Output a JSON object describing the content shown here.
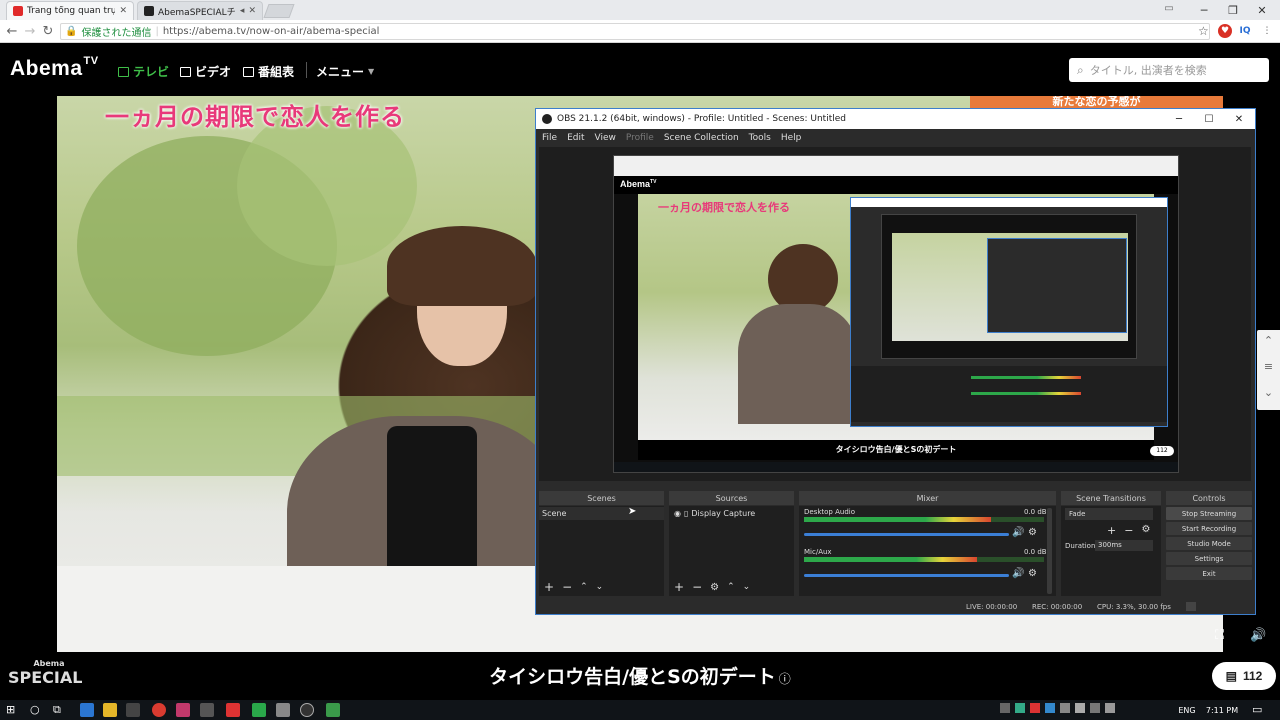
{
  "browser": {
    "tabs": [
      {
        "title": "Trang tổng quan trực tiế",
        "favicon_color": "#e02a2a"
      },
      {
        "title": "AbemaSPECIALチャンネ",
        "favicon_color": "#222222"
      }
    ],
    "secure_label": "保護された通信",
    "url": "https://abema.tv/now-on-air/abema-special",
    "extensions": [
      "IQ"
    ]
  },
  "abema": {
    "logo": "Abema",
    "logo_sup": "TV",
    "nav": [
      {
        "label": "テレビ",
        "active": true
      },
      {
        "label": "ビデオ",
        "active": false
      },
      {
        "label": "番組表",
        "active": false
      }
    ],
    "menu_label": "メニュー",
    "search_placeholder": "タイトル, 出演者を検索"
  },
  "video": {
    "caption": "一ヵ月の期限で恋人を作る",
    "top_right_caption": "新たな恋の予感が"
  },
  "obs": {
    "title": "OBS 21.1.2 (64bit, windows) - Profile: Untitled - Scenes: Untitled",
    "menu": [
      "File",
      "Edit",
      "View",
      "Profile",
      "Scene Collection",
      "Tools",
      "Help"
    ],
    "panels": {
      "scenes": {
        "header": "Scenes",
        "items": [
          "Scene"
        ]
      },
      "sources": {
        "header": "Sources",
        "items": [
          "Display Capture"
        ]
      },
      "mixer": {
        "header": "Mixer",
        "channels": [
          {
            "name": "Desktop Audio",
            "db": "0.0 dB",
            "level": 0.78
          },
          {
            "name": "Mic/Aux",
            "db": "0.0 dB",
            "level": 0.72
          }
        ],
        "scale": [
          "-60",
          "-55",
          "-50",
          "-45",
          "-40",
          "-35",
          "-30",
          "-25",
          "-20",
          "-15",
          "-10",
          "-5",
          "0"
        ]
      },
      "transitions": {
        "header": "Scene Transitions",
        "selected": "Fade",
        "duration_label": "Duration",
        "duration_value": "300ms"
      },
      "controls": {
        "header": "Controls",
        "buttons": [
          "Stop Streaming",
          "Start Recording",
          "Studio Mode",
          "Settings",
          "Exit"
        ]
      }
    },
    "status": {
      "live": "LIVE: 00:00:00",
      "rec": "REC: 00:00:00",
      "cpu": "CPU: 3.3%, 30.00 fps"
    }
  },
  "nested_preview": {
    "program_title": "タイシロウ告白/優とSの初デート",
    "comment_count": "112"
  },
  "bottom": {
    "channel_logo_top": "Abema",
    "channel_logo_bottom": "SPECIAL",
    "program_title": "タイシロウ告白/優とSの初デート",
    "comment_count": "112"
  },
  "taskbar": {
    "lang": "ENG",
    "time": "7:11 PM"
  }
}
